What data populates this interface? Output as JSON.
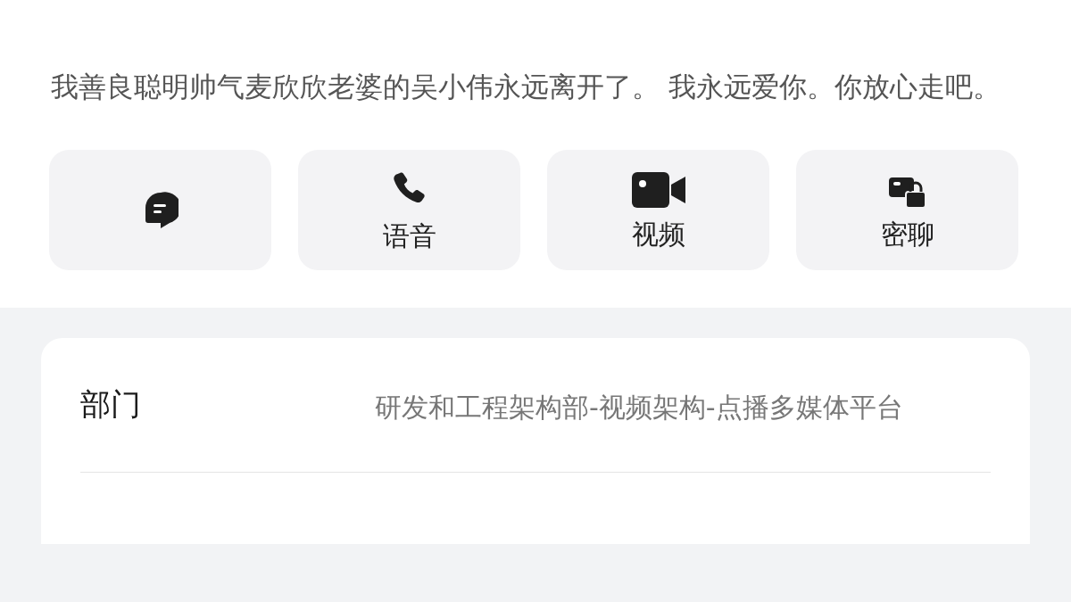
{
  "bio": "我善良聪明帅气麦欣欣老婆的吴小伟永远离开了。 我永远爱你。你放心走吧。",
  "actions": [
    {
      "kind": "message"
    },
    {
      "kind": "call",
      "label": "语音"
    },
    {
      "kind": "video",
      "label": "视频"
    },
    {
      "kind": "secret",
      "label": "密聊"
    }
  ],
  "info": [
    {
      "label": "部门",
      "value": "研发和工程架构部-视频架构-点播多媒体平台"
    }
  ]
}
